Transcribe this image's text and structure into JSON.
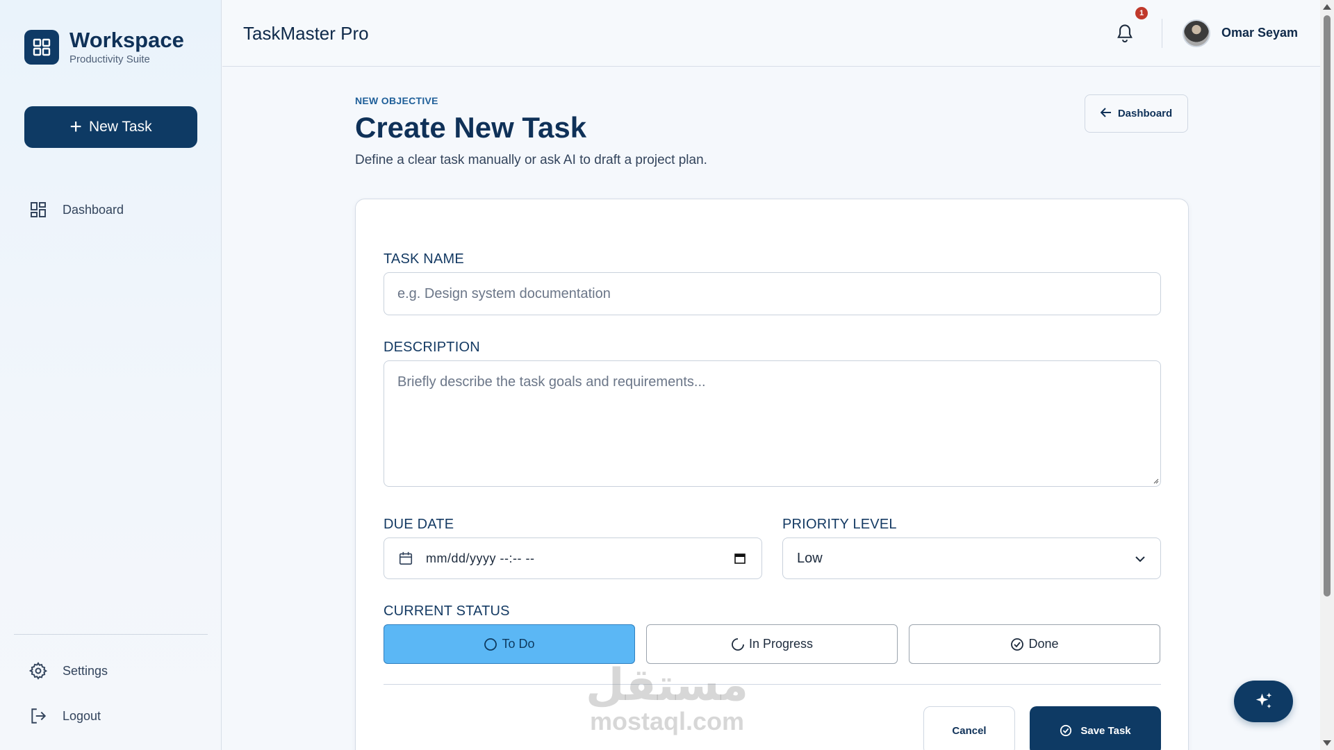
{
  "sidebar": {
    "brand_title": "Workspace",
    "brand_subtitle": "Productivity Suite",
    "new_task_label": "New Task",
    "nav": {
      "dashboard": "Dashboard",
      "settings": "Settings",
      "logout": "Logout"
    }
  },
  "header": {
    "app_title": "TaskMaster Pro",
    "notification_count": "1",
    "user_name": "Omar Seyam"
  },
  "page": {
    "eyebrow": "NEW OBJECTIVE",
    "title": "Create New Task",
    "subtitle": "Define a clear task manually or ask AI to draft a project plan.",
    "back_label": "Dashboard"
  },
  "form": {
    "task_name_label": "TASK NAME",
    "task_name_placeholder": "e.g. Design system documentation",
    "task_name_value": "",
    "description_label": "DESCRIPTION",
    "description_placeholder": "Briefly describe the task goals and requirements...",
    "description_value": "",
    "due_date_label": "DUE DATE",
    "due_date_value": "mm/dd/yyyy --:-- --",
    "priority_label": "PRIORITY LEVEL",
    "priority_value": "Low",
    "status_label": "CURRENT STATUS",
    "status_options": [
      "To Do",
      "In Progress",
      "Done"
    ],
    "status_selected": "To Do",
    "cancel_label": "Cancel",
    "save_label": "Save Task"
  },
  "watermark": {
    "arabic": "مستقل",
    "latin": "mostaql.com"
  },
  "colors": {
    "primary": "#0e3a64",
    "active_status": "#5bb7f5",
    "badge": "#c0392b",
    "eyebrow": "#1f5f99"
  },
  "icons": {
    "brand": "grid-icon",
    "new_task": "plus-icon",
    "dashboard": "dashboard-icon",
    "settings": "gear-icon",
    "logout": "logout-icon",
    "notifications": "bell-icon",
    "back": "arrow-left-icon",
    "calendar": "calendar-icon",
    "priority_dropdown": "chevron-down-icon",
    "status_todo": "circle-icon",
    "status_in_progress": "loader-icon",
    "status_done": "check-circle-icon",
    "save": "check-circle-icon",
    "ai_assistant": "sparkles-icon"
  }
}
